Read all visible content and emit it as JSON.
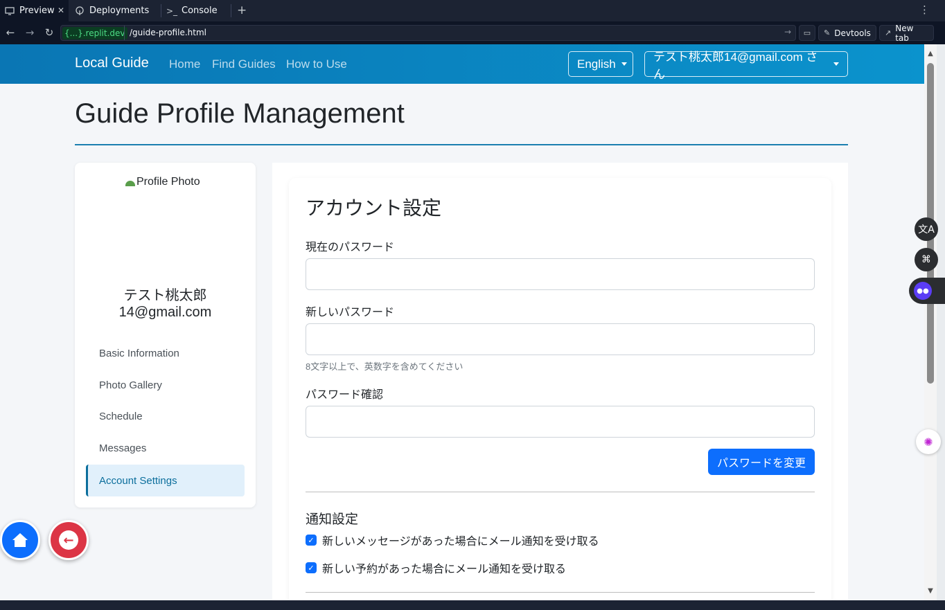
{
  "browser": {
    "tabs": [
      {
        "label": "Preview",
        "icon": "monitor-icon"
      },
      {
        "label": "Deployments",
        "icon": "deploy-icon"
      },
      {
        "label": "Console",
        "icon": "terminal-icon"
      }
    ],
    "url_host": "{...}.replit.dev",
    "url_path": "/guide-profile.html",
    "devtools_label": "Devtools",
    "newtab_label": "New tab"
  },
  "navbar": {
    "brand": "Local Guide",
    "links": [
      "Home",
      "Find Guides",
      "How to Use"
    ],
    "language": "English",
    "user": "テスト桃太郎14@gmail.com さん"
  },
  "page": {
    "title": "Guide Profile Management"
  },
  "sidebar": {
    "photo_alt": "Profile Photo",
    "name_line1": "テスト桃太郎",
    "name_line2": "14@gmail.com",
    "items": [
      {
        "label": "Basic Information"
      },
      {
        "label": "Photo Gallery"
      },
      {
        "label": "Schedule"
      },
      {
        "label": "Messages"
      },
      {
        "label": "Account Settings",
        "active": true
      }
    ]
  },
  "account": {
    "title": "アカウント設定",
    "current_password_label": "現在のパスワード",
    "new_password_label": "新しいパスワード",
    "new_password_help": "8文字以上で、英数字を含めてください",
    "confirm_password_label": "パスワード確認",
    "change_button": "パスワードを変更",
    "notifications_title": "通知設定",
    "notify_messages": "新しいメッセージがあった場合にメール通知を受け取る",
    "notify_bookings": "新しい予約があった場合にメール通知を受け取る"
  },
  "colors": {
    "navbar_start": "#0a76b4",
    "navbar_end": "#0b93cd",
    "primary": "#0d6efd",
    "danger": "#dc3545",
    "active_item": "#e1f0fb"
  }
}
